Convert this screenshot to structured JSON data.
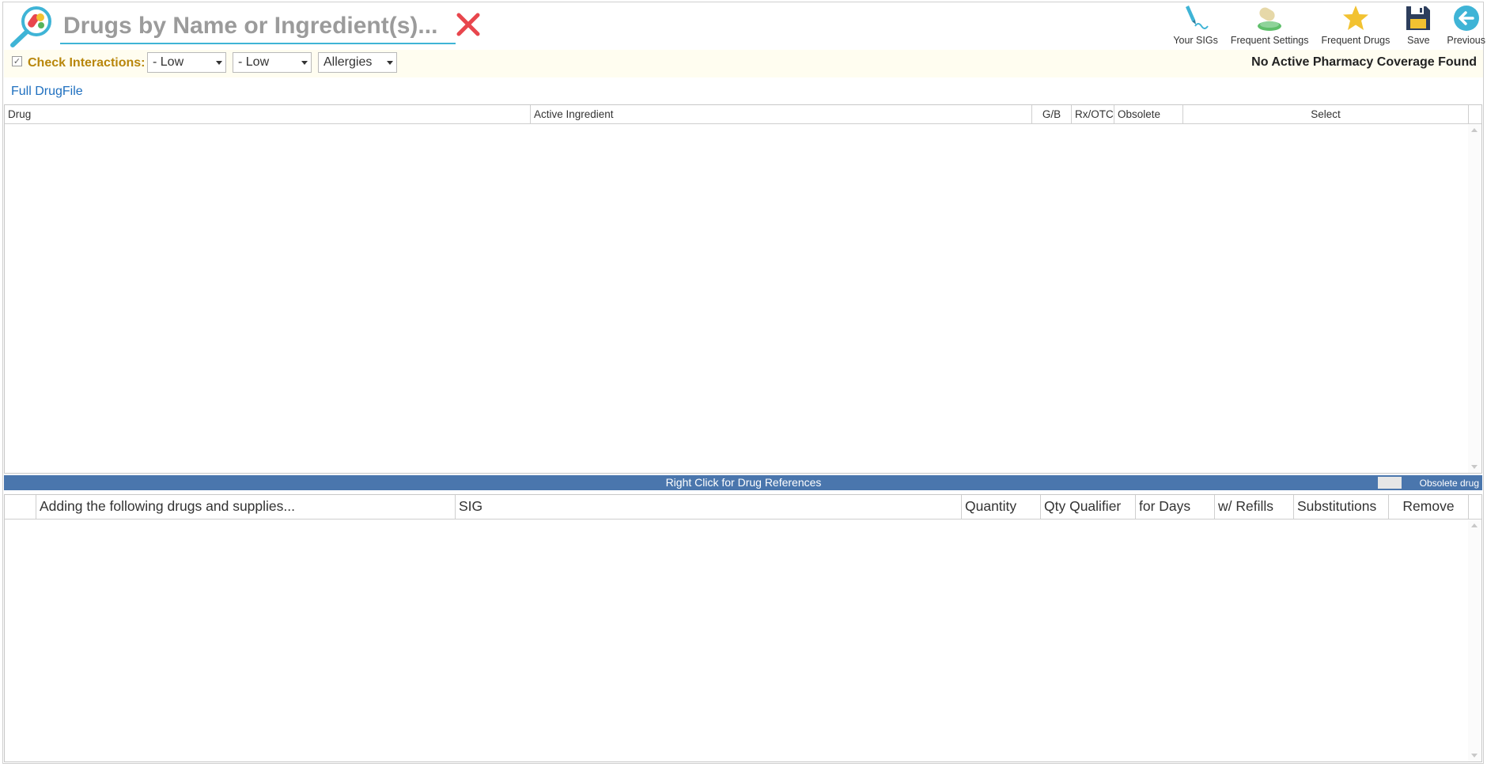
{
  "search": {
    "placeholder": "Drugs by Name or Ingredient(s)..."
  },
  "toolbar": {
    "your_sigs": "Your SIGs",
    "frequent_settings": "Frequent Settings",
    "frequent_drugs": "Frequent Drugs",
    "save": "Save",
    "previous": "Previous"
  },
  "interactions": {
    "label": "Check Interactions:",
    "checked": true,
    "severity_1": "- Low",
    "severity_2": "- Low",
    "allergies": "Allergies"
  },
  "coverage_status": "No Active Pharmacy Coverage Found",
  "drug_file_link": "Full DrugFile",
  "drug_table": {
    "columns": [
      "Drug",
      "Active Ingredient",
      "G/B",
      "Rx/OTC",
      "Obsolete",
      "Select"
    ],
    "rows": []
  },
  "reference_bar": {
    "text": "Right Click for Drug References",
    "legend_label": "Obsolete drug"
  },
  "selected_table": {
    "columns": [
      "",
      "Adding the following drugs and supplies...",
      "SIG",
      "Quantity",
      "Qty Qualifier",
      "for Days",
      "w/ Refills",
      "Substitutions",
      "Remove"
    ],
    "rows": []
  },
  "colors": {
    "accent": "#3fb4d6",
    "link": "#1e6fbf",
    "reference_bar": "#4a76ad",
    "interaction_label": "#b8860b",
    "clear_x": "#e8464d"
  },
  "icons": {
    "logo": "magnifier-pills-icon",
    "clear": "close-icon",
    "your_sigs": "pen-icon",
    "frequent_settings": "pill-bottle-icon",
    "frequent_drugs": "star-icon",
    "save": "floppy-disk-icon",
    "previous": "back-arrow-icon"
  }
}
